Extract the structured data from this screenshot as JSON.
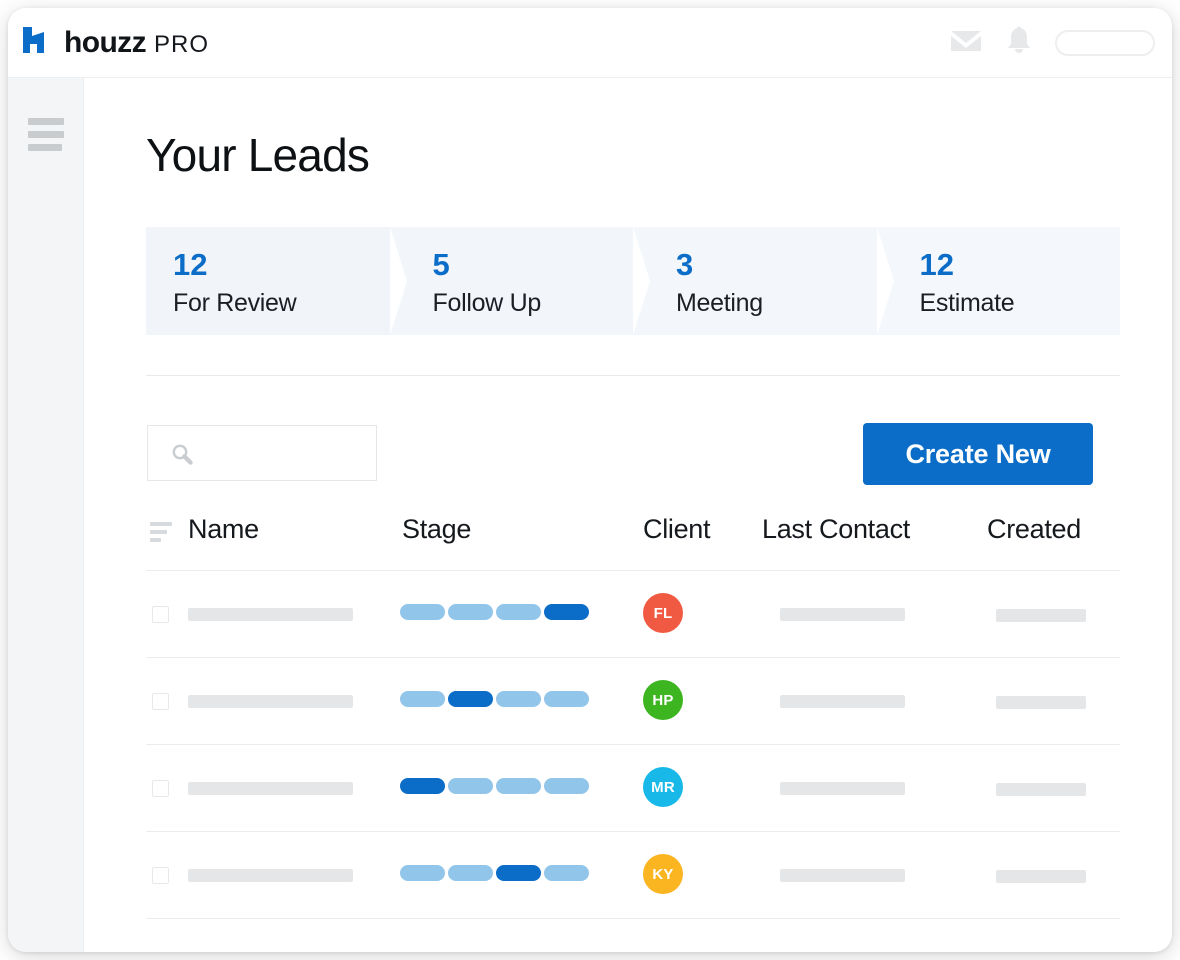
{
  "header": {
    "brand_name": "houzz",
    "brand_suffix": "PRO",
    "icons": {
      "mail": "mail-icon",
      "bell": "bell-icon",
      "account": "account-pill"
    }
  },
  "sidebar": {
    "menu_icon": "hamburger-menu-icon"
  },
  "main": {
    "title": "Your Leads",
    "pipeline": [
      {
        "count": "12",
        "label": "For Review"
      },
      {
        "count": "5",
        "label": "Follow Up"
      },
      {
        "count": "3",
        "label": "Meeting"
      },
      {
        "count": "12",
        "label": "Estimate"
      }
    ],
    "toolbar": {
      "search_value": "",
      "search_placeholder": "",
      "search_icon": "search-icon",
      "create_label": "Create New"
    },
    "table": {
      "sort_icon": "sort-icon",
      "columns": [
        "Name",
        "Stage",
        "Client",
        "Last Contact",
        "Created"
      ],
      "rows": [
        {
          "initials": "FL",
          "avatar_color": "#f15a42",
          "stage_active_index": 3,
          "stage_segments": 4
        },
        {
          "initials": "HP",
          "avatar_color": "#3cb521",
          "stage_active_index": 1,
          "stage_segments": 4
        },
        {
          "initials": "MR",
          "avatar_color": "#18b9e8",
          "stage_active_index": 0,
          "stage_segments": 4
        },
        {
          "initials": "KY",
          "avatar_color": "#fbb521",
          "stage_active_index": 2,
          "stage_segments": 4
        }
      ]
    }
  },
  "colors": {
    "accent_blue": "#0b6dc7",
    "segment_light": "#92c5ea",
    "stage_panel": "#f2f6fb",
    "placeholder_gray": "#e4e6e8"
  }
}
